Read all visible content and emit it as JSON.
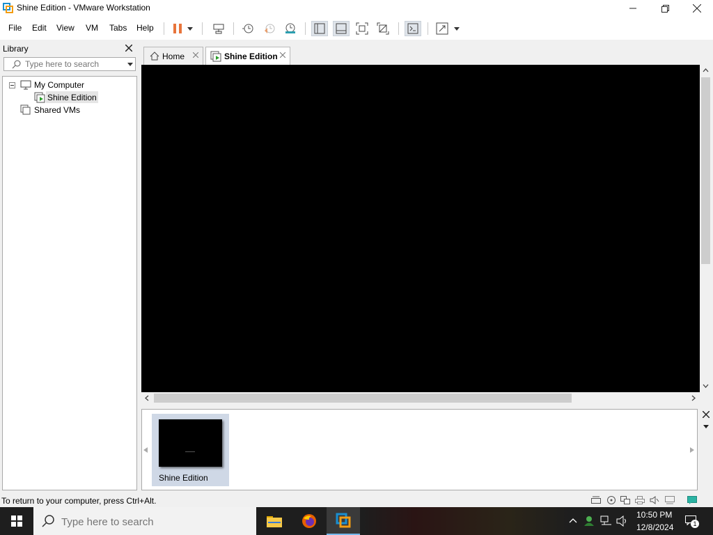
{
  "window": {
    "title": "Shine Edition - VMware Workstation"
  },
  "menu": [
    "File",
    "Edit",
    "View",
    "VM",
    "Tabs",
    "Help"
  ],
  "library": {
    "title": "Library",
    "search_placeholder": "Type here to search",
    "tree": {
      "root": "My Computer",
      "vm": "Shine Edition",
      "shared": "Shared VMs"
    }
  },
  "tabs": [
    {
      "label": "Home",
      "active": false
    },
    {
      "label": "Shine Edition",
      "active": true
    }
  ],
  "thumbnail": {
    "label": "Shine Edition"
  },
  "status": {
    "text": "To return to your computer, press Ctrl+Alt."
  },
  "taskbar": {
    "search_placeholder": "Type here to search",
    "time": "10:50 PM",
    "date": "12/8/2024",
    "notification_count": "1"
  },
  "colors": {
    "accent_orange": "#e8743b",
    "vm_green": "#2c9f2c",
    "taskbar_bg": "#1e1e1e",
    "selected_bg": "#e5e5e5"
  }
}
